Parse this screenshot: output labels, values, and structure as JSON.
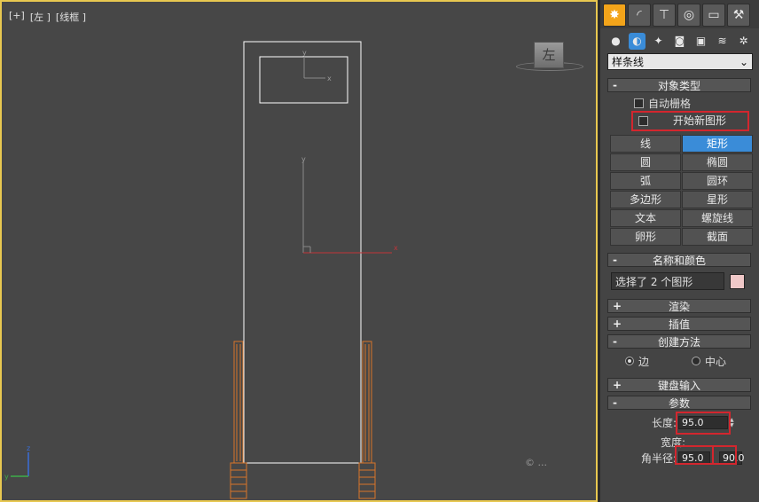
{
  "viewport": {
    "labels": [
      "[+]",
      "[左 ]",
      "[线框 ]"
    ],
    "viewcube_label": "左",
    "watermark": "© ..."
  },
  "panel": {
    "tabs": [
      {
        "icon": "create-icon",
        "glyph": "✸",
        "active": true
      },
      {
        "icon": "modify-icon",
        "glyph": "◜",
        "active": false
      },
      {
        "icon": "hierarchy-icon",
        "glyph": "⊤",
        "active": false
      },
      {
        "icon": "motion-icon",
        "glyph": "◎",
        "active": false
      },
      {
        "icon": "display-icon",
        "glyph": "▭",
        "active": false
      },
      {
        "icon": "utilities-icon",
        "glyph": "⚒",
        "active": false
      }
    ],
    "subicons": [
      {
        "icon": "geometry-icon",
        "glyph": "●",
        "active": false
      },
      {
        "icon": "shapes-icon",
        "glyph": "◐",
        "active": true
      },
      {
        "icon": "lights-icon",
        "glyph": "✦",
        "active": false
      },
      {
        "icon": "cameras-icon",
        "glyph": "◙",
        "active": false
      },
      {
        "icon": "helpers-icon",
        "glyph": "▣",
        "active": false
      },
      {
        "icon": "spacewarps-icon",
        "glyph": "≋",
        "active": false
      },
      {
        "icon": "systems-icon",
        "glyph": "✲",
        "active": false
      }
    ],
    "category": "样条线",
    "object_type": {
      "title": "对象类型",
      "auto_grid": "自动栅格",
      "start_new_shape": "开始新图形",
      "buttons": [
        "线",
        "矩形",
        "圆",
        "椭圆",
        "弧",
        "圆环",
        "多边形",
        "星形",
        "文本",
        "螺旋线",
        "卵形",
        "截面"
      ],
      "active_button": "矩形"
    },
    "name_color": {
      "title": "名称和颜色",
      "name": "选择了 2 个图形",
      "color": "#f0c8c8"
    },
    "render": {
      "title": "渲染"
    },
    "interpolation": {
      "title": "插值"
    },
    "creation_method": {
      "title": "创建方法",
      "edge": "边",
      "center": "中心"
    },
    "keyboard": {
      "title": "键盘输入"
    },
    "parameters": {
      "title": "参数",
      "length_label": "长度:",
      "length_value": "95.0",
      "width_label": "宽度:",
      "corner_label": "角半径:",
      "value2": "95.0",
      "value3": "90.0"
    }
  },
  "colors": {
    "active_tab": "#f3a41a",
    "active_button": "#3a8cd8",
    "highlight_box": "#d3262e",
    "viewport_border": "#e8c850",
    "wire_orange": "#d8742a"
  }
}
